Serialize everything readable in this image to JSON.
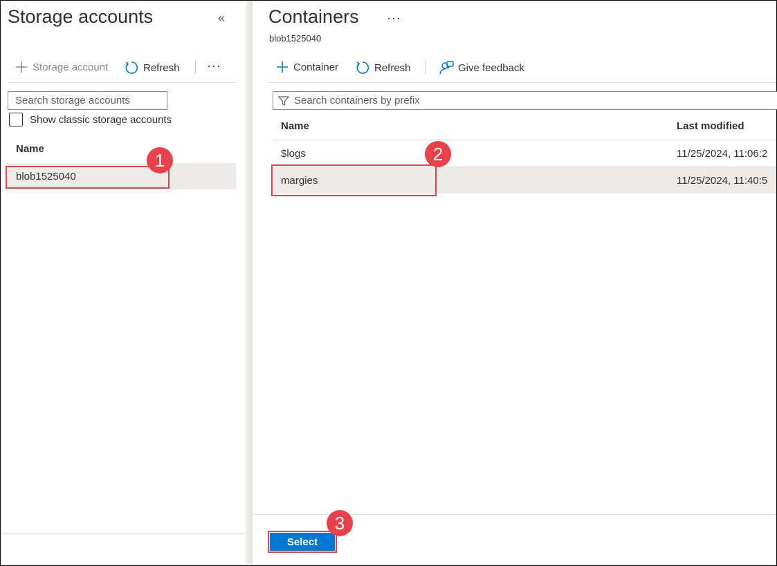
{
  "left_panel": {
    "title": "Storage accounts",
    "collapse_glyph": "«",
    "toolbar": {
      "add_label": "Storage account",
      "refresh_label": "Refresh",
      "more_glyph": "···"
    },
    "search_placeholder": "Search storage accounts",
    "checkbox_label": "Show classic storage accounts",
    "column_name": "Name",
    "rows": [
      {
        "name": "blob1525040"
      }
    ]
  },
  "right_panel": {
    "title": "Containers",
    "subtitle": "blob1525040",
    "more_glyph": "···",
    "toolbar": {
      "container_label": "Container",
      "refresh_label": "Refresh",
      "feedback_label": "Give feedback"
    },
    "search_placeholder": "Search containers by prefix",
    "columns": {
      "name": "Name",
      "last_modified": "Last modified"
    },
    "rows": [
      {
        "name": "$logs",
        "last_modified": "11/25/2024, 11:06:2"
      },
      {
        "name": "margies",
        "last_modified": "11/25/2024, 11:40:5"
      }
    ],
    "select_label": "Select"
  },
  "annotations": {
    "step1": "1",
    "step2": "2",
    "step3": "3"
  },
  "colors": {
    "accent": "#0078d4",
    "annotation": "#e8414a",
    "selected_row": "#edebe9"
  },
  "icons": [
    "plus-icon",
    "refresh-icon",
    "ellipsis-icon",
    "filter-icon",
    "feedback-icon",
    "collapse-icon"
  ]
}
